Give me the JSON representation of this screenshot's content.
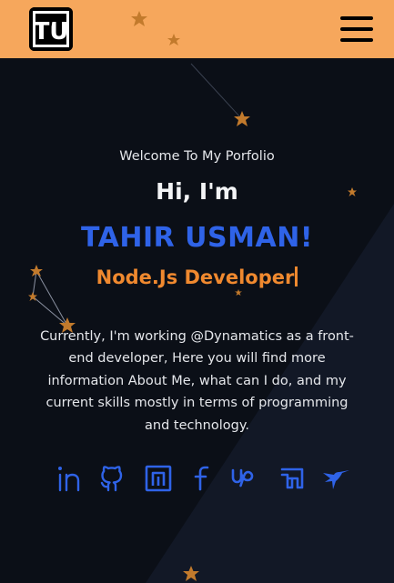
{
  "header": {
    "logo_text": "TU",
    "menu_icon": "hamburger-menu-icon",
    "accent_color": "#f6a75c"
  },
  "hero": {
    "welcome": "Welcome To My Porfolio",
    "greeting": "Hi, I'm",
    "name": "TAHIR USMAN!",
    "role": "Node.Js Developer",
    "description": "Currently, I'm working @Dynamatics as a front-end developer, Here you will find more information About Me, what can I do, and my current skills mostly in terms of programming and technology.",
    "name_color": "#2f63e8",
    "role_color": "#f0892f"
  },
  "socials": [
    {
      "icon": "linkedin-icon"
    },
    {
      "icon": "github-icon"
    },
    {
      "icon": "npm-icon"
    },
    {
      "icon": "facebook-icon"
    },
    {
      "icon": "upwork-icon"
    },
    {
      "icon": "fiverr-icon"
    },
    {
      "icon": "hummingbird-icon"
    }
  ]
}
